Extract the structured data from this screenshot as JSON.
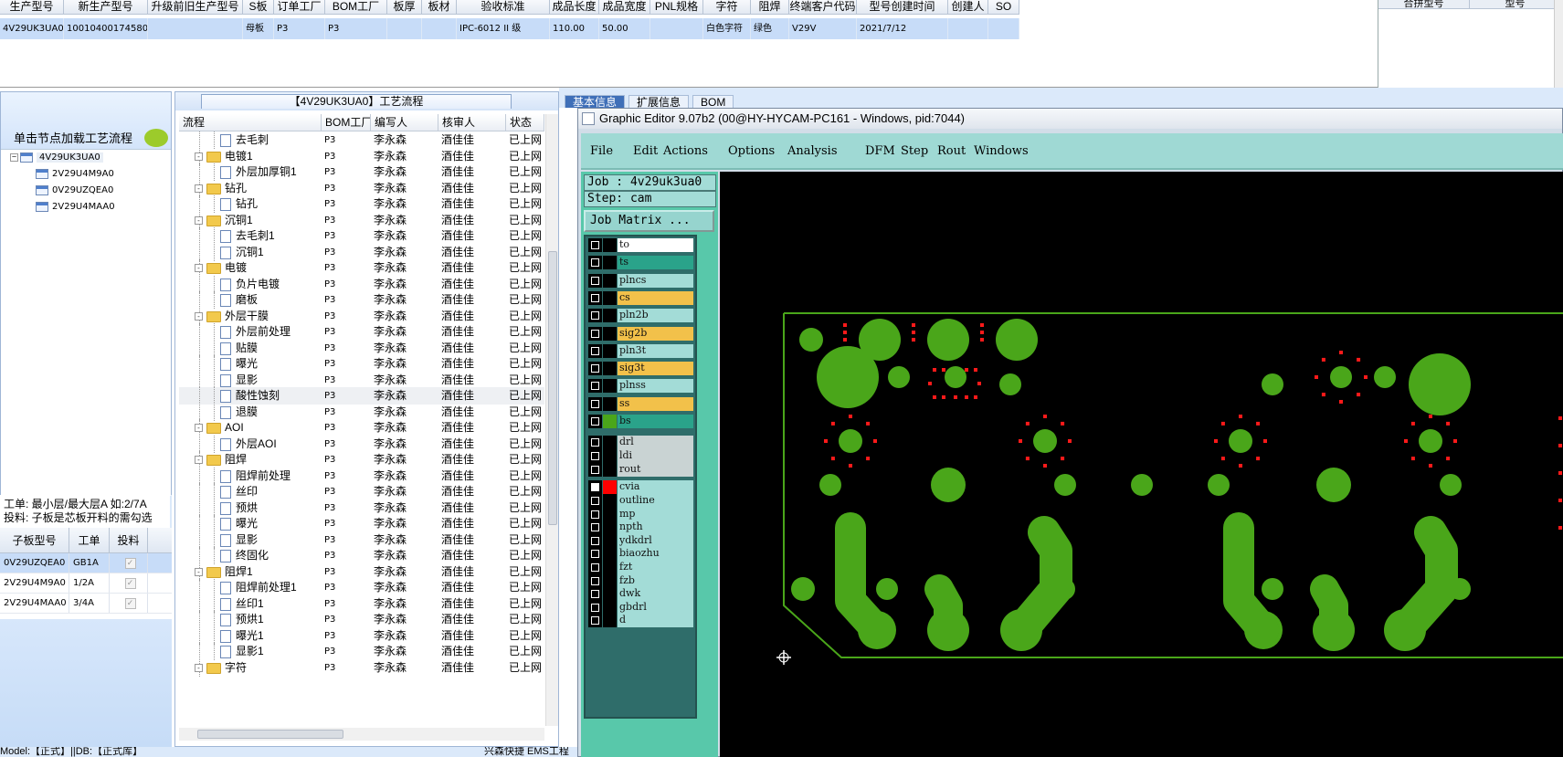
{
  "top_grid": {
    "headers": [
      "生产型号",
      "新生产型号",
      "升级前旧生产型号",
      "S板",
      "订单工厂",
      "BOM工厂",
      "板厚",
      "板材",
      "验收标准",
      "成品长度",
      "成品宽度",
      "PNL规格",
      "字符",
      "阻焊",
      "终端客户代码",
      "型号创建时间",
      "创建人",
      "SO"
    ],
    "row": [
      "4V29UK3UA0",
      "10010400174580",
      "",
      "母板",
      "P3",
      "P3",
      "",
      "",
      "IPC-6012 II 级",
      "110.00",
      "50.00",
      "",
      "白色字符",
      "绿色",
      "V29V",
      "2021/7/12",
      "",
      ""
    ]
  },
  "right_panel": {
    "headers": [
      "合拼型号",
      "型号"
    ]
  },
  "left_panel": {
    "title": "单击节点加载工艺流程",
    "tree": [
      {
        "label": "4V29UK3UA0",
        "level": 0
      },
      {
        "label": "2V29U4M9A0",
        "level": 1
      },
      {
        "label": "0V29UZQEA0",
        "level": 1
      },
      {
        "label": "2V29U4MAA0",
        "level": 1
      }
    ],
    "info_line1": "工单: 最小层/最大层A 如:2/7A",
    "info_line2": "投料: 子板是芯板开料的需勾选",
    "grid_headers": [
      "子板型号",
      "工单",
      "投料"
    ],
    "grid_rows": [
      {
        "model": "0V29UZQEA0",
        "order": "GB1A",
        "checked": "✓"
      },
      {
        "model": "2V29U4M9A0",
        "order": "1/2A",
        "checked": "✓"
      },
      {
        "model": "2V29U4MAA0",
        "order": "3/4A",
        "checked": "✓"
      }
    ]
  },
  "process_panel": {
    "title": "【4V29UK3UA0】工艺流程",
    "columns": [
      "流程",
      "BOM工厂",
      "编写人",
      "核审人",
      "状态"
    ],
    "rows": [
      {
        "name": "去毛刺",
        "type": "leaf",
        "bom": "P3",
        "author": "李永森",
        "reviewer": "酒佳佳",
        "status": "已上网"
      },
      {
        "name": "电镀1",
        "type": "group",
        "bom": "P3",
        "author": "李永森",
        "reviewer": "酒佳佳",
        "status": "已上网"
      },
      {
        "name": "外层加厚铜1",
        "type": "leaf",
        "bom": "P3",
        "author": "李永森",
        "reviewer": "酒佳佳",
        "status": "已上网"
      },
      {
        "name": "钻孔",
        "type": "group",
        "bom": "P3",
        "author": "李永森",
        "reviewer": "酒佳佳",
        "status": "已上网"
      },
      {
        "name": "钻孔",
        "type": "leaf",
        "bom": "P3",
        "author": "李永森",
        "reviewer": "酒佳佳",
        "status": "已上网"
      },
      {
        "name": "沉铜1",
        "type": "group",
        "bom": "P3",
        "author": "李永森",
        "reviewer": "酒佳佳",
        "status": "已上网"
      },
      {
        "name": "去毛刺1",
        "type": "leaf",
        "bom": "P3",
        "author": "李永森",
        "reviewer": "酒佳佳",
        "status": "已上网"
      },
      {
        "name": "沉铜1",
        "type": "leaf",
        "bom": "P3",
        "author": "李永森",
        "reviewer": "酒佳佳",
        "status": "已上网"
      },
      {
        "name": "电镀",
        "type": "group",
        "bom": "P3",
        "author": "李永森",
        "reviewer": "酒佳佳",
        "status": "已上网"
      },
      {
        "name": "负片电镀",
        "type": "leaf",
        "bom": "P3",
        "author": "李永森",
        "reviewer": "酒佳佳",
        "status": "已上网"
      },
      {
        "name": "磨板",
        "type": "leaf",
        "bom": "P3",
        "author": "李永森",
        "reviewer": "酒佳佳",
        "status": "已上网"
      },
      {
        "name": "外层干膜",
        "type": "group",
        "bom": "P3",
        "author": "李永森",
        "reviewer": "酒佳佳",
        "status": "已上网"
      },
      {
        "name": "外层前处理",
        "type": "leaf",
        "bom": "P3",
        "author": "李永森",
        "reviewer": "酒佳佳",
        "status": "已上网"
      },
      {
        "name": "贴膜",
        "type": "leaf",
        "bom": "P3",
        "author": "李永森",
        "reviewer": "酒佳佳",
        "status": "已上网"
      },
      {
        "name": "曝光",
        "type": "leaf",
        "bom": "P3",
        "author": "李永森",
        "reviewer": "酒佳佳",
        "status": "已上网"
      },
      {
        "name": "显影",
        "type": "leaf",
        "bom": "P3",
        "author": "李永森",
        "reviewer": "酒佳佳",
        "status": "已上网"
      },
      {
        "name": "酸性蚀刻",
        "type": "leaf",
        "bom": "P3",
        "author": "李永森",
        "reviewer": "酒佳佳",
        "status": "已上网",
        "highlight": true
      },
      {
        "name": "退膜",
        "type": "leaf",
        "bom": "P3",
        "author": "李永森",
        "reviewer": "酒佳佳",
        "status": "已上网"
      },
      {
        "name": "AOI",
        "type": "group",
        "bom": "P3",
        "author": "李永森",
        "reviewer": "酒佳佳",
        "status": "已上网"
      },
      {
        "name": "外层AOI",
        "type": "leaf",
        "bom": "P3",
        "author": "李永森",
        "reviewer": "酒佳佳",
        "status": "已上网"
      },
      {
        "name": "阻焊",
        "type": "group",
        "bom": "P3",
        "author": "李永森",
        "reviewer": "酒佳佳",
        "status": "已上网"
      },
      {
        "name": "阻焊前处理",
        "type": "leaf",
        "bom": "P3",
        "author": "李永森",
        "reviewer": "酒佳佳",
        "status": "已上网"
      },
      {
        "name": "丝印",
        "type": "leaf",
        "bom": "P3",
        "author": "李永森",
        "reviewer": "酒佳佳",
        "status": "已上网"
      },
      {
        "name": "预烘",
        "type": "leaf",
        "bom": "P3",
        "author": "李永森",
        "reviewer": "酒佳佳",
        "status": "已上网"
      },
      {
        "name": "曝光",
        "type": "leaf",
        "bom": "P3",
        "author": "李永森",
        "reviewer": "酒佳佳",
        "status": "已上网"
      },
      {
        "name": "显影",
        "type": "leaf",
        "bom": "P3",
        "author": "李永森",
        "reviewer": "酒佳佳",
        "status": "已上网"
      },
      {
        "name": "终固化",
        "type": "leaf",
        "bom": "P3",
        "author": "李永森",
        "reviewer": "酒佳佳",
        "status": "已上网"
      },
      {
        "name": "阻焊1",
        "type": "group",
        "bom": "P3",
        "author": "李永森",
        "reviewer": "酒佳佳",
        "status": "已上网"
      },
      {
        "name": "阻焊前处理1",
        "type": "leaf",
        "bom": "P3",
        "author": "李永森",
        "reviewer": "酒佳佳",
        "status": "已上网"
      },
      {
        "name": "丝印1",
        "type": "leaf",
        "bom": "P3",
        "author": "李永森",
        "reviewer": "酒佳佳",
        "status": "已上网"
      },
      {
        "name": "预烘1",
        "type": "leaf",
        "bom": "P3",
        "author": "李永森",
        "reviewer": "酒佳佳",
        "status": "已上网"
      },
      {
        "name": "曝光1",
        "type": "leaf",
        "bom": "P3",
        "author": "李永森",
        "reviewer": "酒佳佳",
        "status": "已上网"
      },
      {
        "name": "显影1",
        "type": "leaf",
        "bom": "P3",
        "author": "李永森",
        "reviewer": "酒佳佳",
        "status": "已上网"
      },
      {
        "name": "字符",
        "type": "group",
        "bom": "P3",
        "author": "李永森",
        "reviewer": "酒佳佳",
        "status": "已上网"
      }
    ]
  },
  "status_bar": {
    "left": "Model:【正式】||DB:【正式库】",
    "right": "兴森快捷 EMS工程"
  },
  "background_tabs": [
    "基本信息",
    "扩展信息",
    "BOM"
  ],
  "graphic_editor": {
    "title": "Graphic Editor 9.07b2 (00@HY-HYCAM-PC161 - Windows, pid:7044)",
    "menu": [
      "File",
      "Edit",
      "Actions",
      "Options",
      "Analysis",
      "DFM",
      "Step",
      "Rout",
      "Windows"
    ],
    "job": "Job : 4v29uk3ua0",
    "step": "Step: cam",
    "job_matrix_button": "Job Matrix ...",
    "layers_top": [
      {
        "name": "to",
        "style": "w",
        "color": "#000000",
        "on": false
      },
      {
        "name": "ts",
        "style": "t",
        "color": "#000000",
        "on": false
      },
      {
        "name": "plncs",
        "style": "n",
        "color": "#000000",
        "on": false
      },
      {
        "name": "cs",
        "style": "y",
        "color": "#000000",
        "on": false
      },
      {
        "name": "pln2b",
        "style": "n",
        "color": "#000000",
        "on": false
      },
      {
        "name": "sig2b",
        "style": "y",
        "color": "#000000",
        "on": false
      },
      {
        "name": "pln3t",
        "style": "n",
        "color": "#000000",
        "on": false
      },
      {
        "name": "sig3t",
        "style": "y",
        "color": "#000000",
        "on": false
      },
      {
        "name": "plnss",
        "style": "n",
        "color": "#000000",
        "on": false
      },
      {
        "name": "ss",
        "style": "y",
        "color": "#000000",
        "on": false
      },
      {
        "name": "bs",
        "style": "t",
        "color": "#4aa61a",
        "on": false
      }
    ],
    "layers_mid": [
      {
        "name": "drl",
        "style": "g",
        "color": "#000000",
        "on": false
      },
      {
        "name": "ldi",
        "style": "g",
        "color": "#000000",
        "on": false
      },
      {
        "name": "rout",
        "style": "g",
        "color": "#000000",
        "on": false
      }
    ],
    "layers_bottom": [
      {
        "name": "cvia",
        "style": "n",
        "color": "#ff0000",
        "on": true
      },
      {
        "name": "outline",
        "style": "n",
        "color": "#000000",
        "on": false
      },
      {
        "name": "mp",
        "style": "n",
        "color": "#000000",
        "on": false
      },
      {
        "name": "npth",
        "style": "n",
        "color": "#000000",
        "on": false
      },
      {
        "name": "ydkdrl",
        "style": "n",
        "color": "#000000",
        "on": false
      },
      {
        "name": "biaozhu",
        "style": "n",
        "color": "#000000",
        "on": false
      },
      {
        "name": "fzt",
        "style": "n",
        "color": "#000000",
        "on": false
      },
      {
        "name": "fzb",
        "style": "n",
        "color": "#000000",
        "on": false
      },
      {
        "name": "dwk",
        "style": "n",
        "color": "#000000",
        "on": false
      },
      {
        "name": "gbdrl",
        "style": "n",
        "color": "#000000",
        "on": false
      },
      {
        "name": "d",
        "style": "n",
        "color": "#000000",
        "on": false
      }
    ],
    "canvas_colors": {
      "board": "#4aa61a",
      "via": "#ff1a1a",
      "background": "#000000"
    }
  }
}
